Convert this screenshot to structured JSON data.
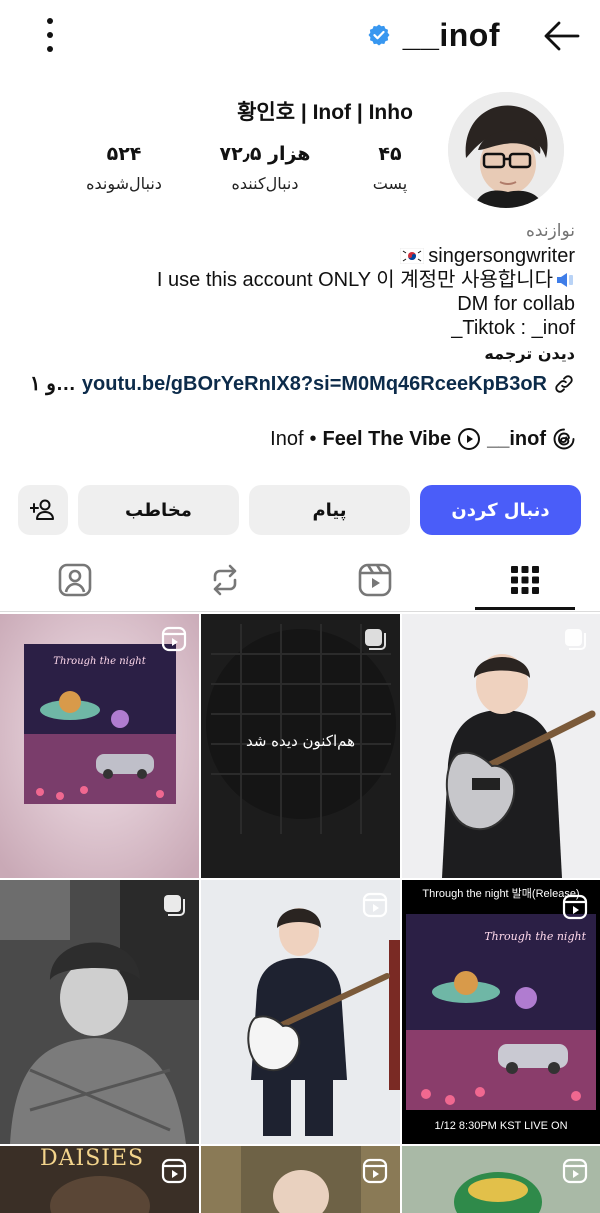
{
  "header": {
    "username": "__inof",
    "colors": {
      "accent": "#4a5df9",
      "verified": "#3897f0"
    }
  },
  "profile": {
    "display_name": "황인호 | Inof | Inho",
    "stats": [
      {
        "value": "۴۵",
        "label": "پست"
      },
      {
        "value": "۷۲٫۵ هزار",
        "label": "دنبال‌کننده"
      },
      {
        "value": "۵۲۴",
        "label": "دنبال‌شونده"
      }
    ]
  },
  "bio": {
    "category": "نوازنده",
    "line1": "singersongwriter",
    "line2": "I use this account ONLY 이 계정만 사용합니다",
    "line3": "DM for collab",
    "line4": "_Tiktok : _inof",
    "translate": "دیدن ترجمه",
    "link": "youtu.be/gBOrYeRnIX8?si=M0Mq46RceeKpB3oR",
    "link_more": "و ۱…"
  },
  "meta": {
    "name": "Inof",
    "separator": "•",
    "song": "Feel The Vibe",
    "threads_handle": "__inof"
  },
  "actions": {
    "follow": "دنبال کردن",
    "message": "پیام",
    "contact": "مخاطب"
  },
  "tabs": [
    "posts-grid",
    "reels",
    "reposts",
    "tagged"
  ],
  "grid": {
    "item2_overlay": "هم‌اکنون دیده شد",
    "item6_top": "Through the night 발매(Release)",
    "item6_bottom": "1/12 8:30PM KST LIVE ON",
    "item1_title": "Through the night",
    "item6_title": "Through the night",
    "item7_title": "DAISIES"
  }
}
